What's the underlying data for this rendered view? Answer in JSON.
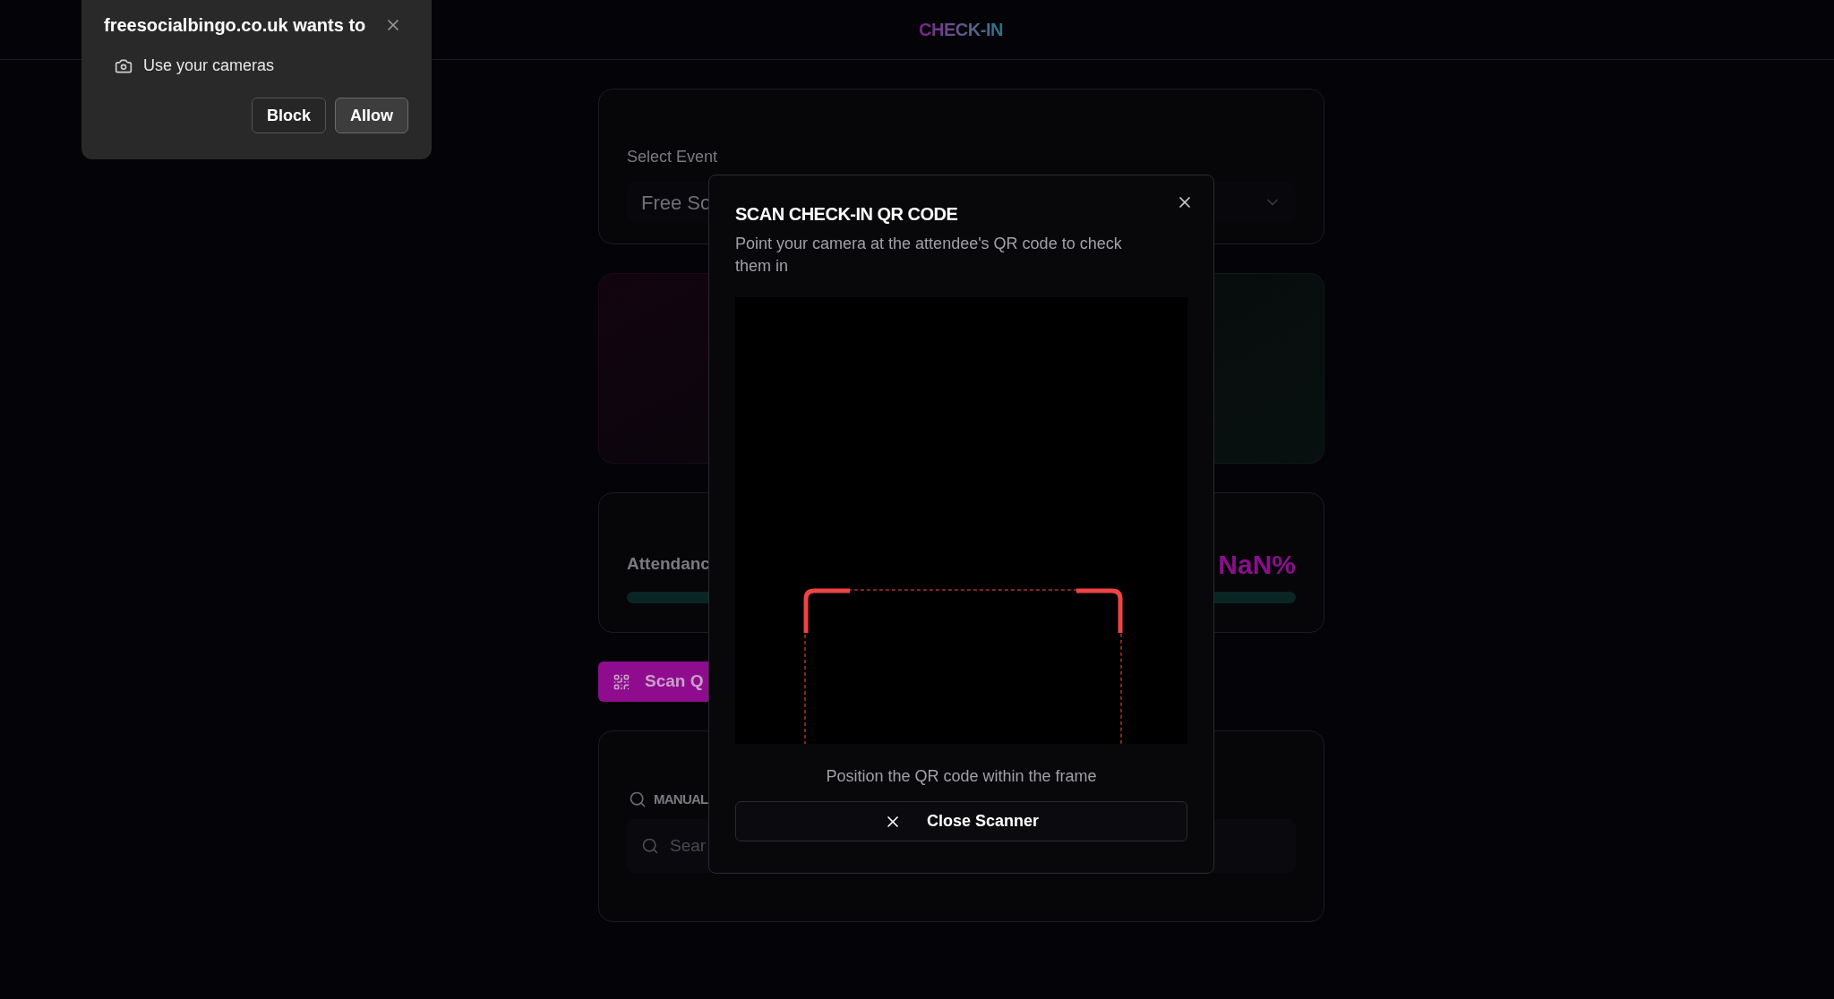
{
  "popup": {
    "title": "freesocialbingo.co.uk wants to",
    "permission": "Use your cameras",
    "buttons": [
      {
        "label": "Block",
        "kind": "secondary"
      },
      {
        "label": "Allow",
        "kind": "primary"
      }
    ]
  },
  "header": {
    "title": "CHECK-IN"
  },
  "event_card": {
    "label": "Select Event",
    "value": "Free So"
  },
  "attendance": {
    "label": "Attendanc",
    "percent": "NaN%",
    "level": 0
  },
  "scan_button": {
    "label": "Scan Q"
  },
  "manual_search": {
    "heading": "MANUAL",
    "placeholder": "Sear"
  },
  "modal": {
    "title": "SCAN CHECK-IN QR CODE",
    "description": "Point your camera at the attendee's QR code to check them in",
    "hint": "Position the QR code within the frame",
    "close_button": "Close Scanner"
  }
}
